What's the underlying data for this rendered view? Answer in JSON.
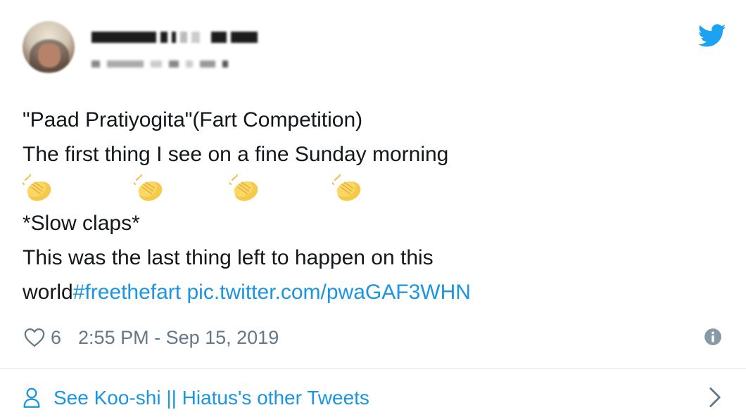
{
  "tweet": {
    "lines": {
      "line1": "\"Paad Pratiyogita\"(Fart Competition)",
      "line2": "The first thing I see on a fine Sunday morning",
      "line3": "*Slow claps*",
      "line4": "This was the last thing left to happen on this",
      "line5_plain": "world",
      "line5_hashtag": "#freethefart",
      "line5_link": "pic.twitter.com/pwaGAF3WHN"
    },
    "clap_emoji_count": 4
  },
  "meta": {
    "likes": "6",
    "timestamp": "2:55 PM - Sep 15, 2019"
  },
  "footer": {
    "other_tweets_label": "See Koo-shi || Hiatus's other Tweets"
  },
  "colors": {
    "link": "#1b95e0",
    "text": "#14171a",
    "muted": "#657786",
    "divider": "#e1e8ed"
  },
  "icons": [
    "twitter-bird-icon",
    "heart-icon",
    "info-icon",
    "person-icon",
    "chevron-right-icon",
    "clapping-hands-emoji"
  ]
}
